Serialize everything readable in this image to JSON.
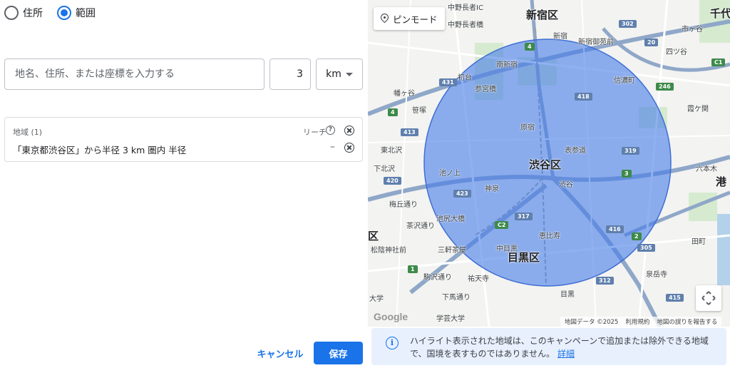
{
  "mode": {
    "options": [
      {
        "label": "住所",
        "selected": false
      },
      {
        "label": "範囲",
        "selected": true
      }
    ]
  },
  "location_input": {
    "placeholder": "地名、住所、または座標を入力する",
    "value": ""
  },
  "radius": {
    "value": "3",
    "unit": "km"
  },
  "regions": {
    "header": "地域 (1)",
    "reach_label": "リーチ",
    "items": [
      {
        "text": "「東京都渋谷区」から半径 3 km 圏内 半径",
        "reach": "–"
      }
    ]
  },
  "map": {
    "pin_mode_label": "ピンモード",
    "footer": {
      "data": "地図データ ©2025",
      "terms": "利用規約",
      "report": "地図の誤りを報告する"
    },
    "logo_text": "Google",
    "labels": {
      "shinjuku": "新宿区",
      "shibuya": "渋谷区",
      "meguro": "目黒区",
      "minato": "港",
      "chiyoda": "千代",
      "setagaya_ku": "区",
      "nakano_ic": "中野長者IC",
      "nakano_choja": "中野長者橋",
      "shinjuku_st": "新宿",
      "shinjuku_gyoen": "新宿御苑前",
      "yotsuya": "四ツ谷",
      "ichigaya": "市ヶ谷",
      "minami_shinjuku": "南新宿",
      "hatsudai": "初台",
      "sangubashi": "参宮橋",
      "shinanomachi": "信濃町",
      "hatagaya": "幡ヶ谷",
      "sasazuka": "笹塚",
      "harajuku": "原宿",
      "omotesando": "表参道",
      "kasumigaoka": "霞ケ関",
      "higashi_kitazawa": "東北沢",
      "shimo_kitazawa": "下北沢",
      "ikenoue": "池ノ上",
      "shinsen": "神泉",
      "shibuya_st": "渋谷",
      "roppongi": "六本木",
      "umegaoka": "梅丘通り",
      "ikejiri": "池尻大橋",
      "ebisu": "恵比寿",
      "matsukage": "松陰神社前",
      "sangenjaya": "三軒茶屋",
      "nakameguro": "中目黒",
      "yutenji": "祐天寺",
      "meguro_st": "目黒",
      "sengakuji": "泉岳寺",
      "tamachi": "田町",
      "gakugei": "学芸大学",
      "komazawa": "駒沢通り",
      "shimouma": "下馬通り",
      "setagaya_dai": "大学",
      "kan7": "茶沢通り"
    },
    "route_shields": [
      "302",
      "20",
      "431",
      "4",
      "413",
      "420",
      "423",
      "317",
      "416",
      "418",
      "312",
      "319",
      "3",
      "305",
      "415",
      "246",
      "C1",
      "C2",
      "4",
      "1",
      "2"
    ],
    "highlight_color": "#4a7fe8"
  },
  "info_banner": {
    "icon": "info-icon",
    "text": "ハイライト表示された地域は、このキャンペーンで追加または除外できる地域で、国境を表すものではありません。",
    "link": "詳細"
  },
  "actions": {
    "cancel": "キャンセル",
    "save": "保存"
  }
}
